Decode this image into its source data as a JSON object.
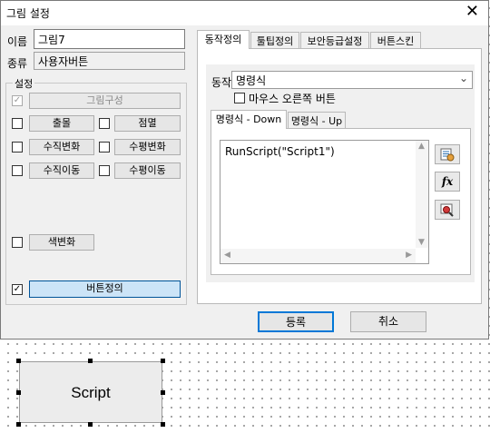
{
  "window": {
    "title": "그림 설정",
    "close_glyph": "✕"
  },
  "name_label": "이름",
  "name_value": "그림7",
  "type_label": "종류",
  "type_value": "사용자버튼",
  "settings": {
    "group_title": "설정",
    "picture_config": "그림구성",
    "blink": "출몰",
    "dot": "점멸",
    "vertical_change": "수직변화",
    "horizontal_change": "수평변화",
    "vertical_move": "수직이동",
    "horizontal_move": "수평이동",
    "color_change": "색변화",
    "button_define": "버튼정의",
    "checkmark": "✓"
  },
  "tabs": [
    "동작정의",
    "툴팁정의",
    "보안등급설정",
    "버튼스킨"
  ],
  "action": {
    "label": "동작",
    "value": "명령식",
    "right_click_label": "마우스 오른쪽 버튼",
    "subtabs": [
      "명령식 - Down",
      "명령식 - Up"
    ],
    "script": "RunScript(\"Script1\")"
  },
  "tools": [
    "script-edit-icon",
    "function-icon",
    "pick-icon"
  ],
  "tool_glyphs": {
    "fx": "fx"
  },
  "footer": {
    "ok": "등록",
    "cancel": "취소"
  },
  "canvas_object": {
    "label": "Script"
  }
}
